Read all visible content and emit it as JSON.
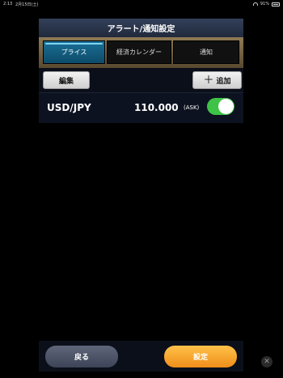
{
  "status_bar": {
    "time": "2:13",
    "date": "2月15日(土)",
    "battery": "91%"
  },
  "panel": {
    "title": "アラート/通知設定",
    "tabs": [
      {
        "label": "プライス",
        "active": true
      },
      {
        "label": "経済カレンダー",
        "active": false
      },
      {
        "label": "通知",
        "active": false
      }
    ],
    "edit_label": "編集",
    "add_label": "追加",
    "alert_row": {
      "pair": "USD/JPY",
      "price": "110.000",
      "side": "(ASK)",
      "enabled": true
    }
  },
  "bottom": {
    "back_label": "戻る",
    "set_label": "設定"
  },
  "colors": {
    "active_tab": "#1a6f96",
    "toggle_on": "#3ec247",
    "set_button": "#f5a32a"
  },
  "icons": {
    "add": "plus-icon",
    "close": "close-icon",
    "wifi": "wifi-icon",
    "battery": "battery-icon"
  }
}
